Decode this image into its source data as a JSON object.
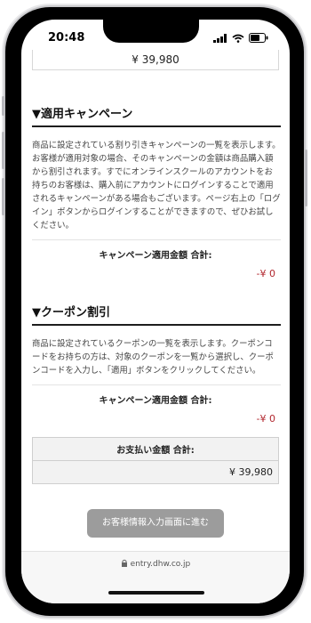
{
  "status_bar": {
    "time": "20:48"
  },
  "order": {
    "price_top": "¥ 39,980"
  },
  "campaign_section": {
    "title": "▼適用キャンペーン",
    "description": "商品に設定されている割り引きキャンペーンの一覧を表示します。お客様が適用対象の場合、そのキャンペーンの金額は商品購入額から割引されます。すでにオンラインスクールのアカウントをお持ちのお客様は、購入前にアカウントにログインすることで適用されるキャンペーンがある場合もございます。ページ右上の「ログイン」ボタンからログインすることができますので、ぜひお試しください。",
    "total_label": "キャンペーン適用金額 合計:",
    "total_value": "-¥ 0"
  },
  "coupon_section": {
    "title": "▼クーポン割引",
    "description": "商品に設定されているクーポンの一覧を表示します。クーポンコードをお持ちの方は、対象のクーポンを一覧から選択し、クーポンコードを入力し、「適用」ボタンをクリックしてください。",
    "total_label": "キャンペーン適用金額 合計:",
    "total_value": "-¥ 0"
  },
  "payment": {
    "label": "お支払い金額 合計:",
    "value": "¥ 39,980"
  },
  "next_button": {
    "label": "お客様情報入力画面に進む"
  },
  "browser": {
    "url": "entry.dhw.co.jp"
  }
}
